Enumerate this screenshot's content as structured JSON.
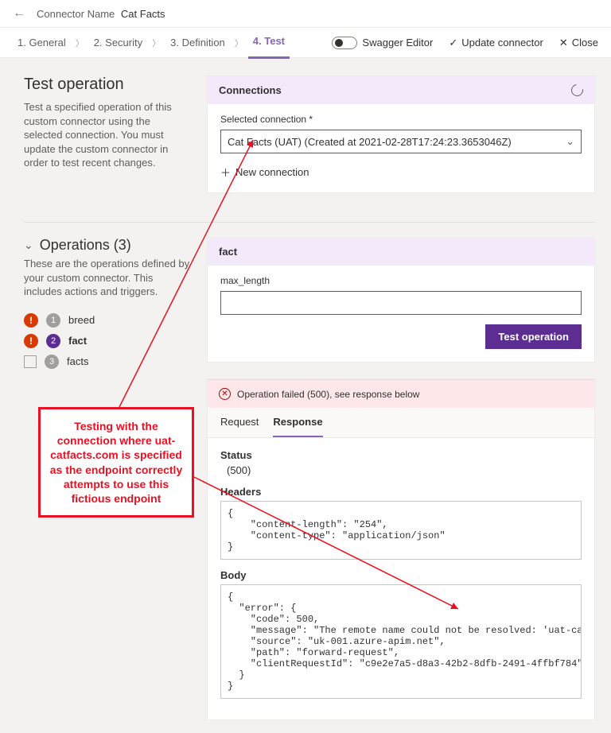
{
  "header": {
    "connector_label": "Connector Name",
    "connector_value": "Cat Facts"
  },
  "tabs": {
    "general": "1. General",
    "security": "2. Security",
    "definition": "3. Definition",
    "test": "4. Test",
    "swagger": "Swagger Editor",
    "update": "Update connector",
    "close": "Close"
  },
  "test_op": {
    "title": "Test operation",
    "desc": "Test a specified operation of this custom connector using the selected connection. You must update the custom connector in order to test recent changes."
  },
  "connections": {
    "header": "Connections",
    "selected_label": "Selected connection *",
    "selected_value": "Cat Facts (UAT) (Created at 2021-02-28T17:24:23.3653046Z)",
    "new_connection": "New connection"
  },
  "operations": {
    "title": "Operations (3)",
    "desc": "These are the operations defined by your custom connector. This includes actions and triggers.",
    "items": [
      {
        "num": "1",
        "name": "breed",
        "alert": true,
        "selected": false
      },
      {
        "num": "2",
        "name": "fact",
        "alert": true,
        "selected": true
      },
      {
        "num": "3",
        "name": "facts",
        "alert": false,
        "selected": false
      }
    ]
  },
  "fact_card": {
    "header": "fact",
    "param_label": "max_length",
    "param_value": "",
    "button": "Test operation"
  },
  "result": {
    "error_banner": "Operation failed (500), see response below",
    "tabs": {
      "request": "Request",
      "response": "Response"
    },
    "status_label": "Status",
    "status_value": "(500)",
    "headers_label": "Headers",
    "headers_text": "{\n    \"content-length\": \"254\",\n    \"content-type\": \"application/json\"\n}",
    "body_label": "Body",
    "body_text": "{\n  \"error\": {\n    \"code\": 500,\n    \"message\": \"The remote name could not be resolved: 'uat-catfacts.com'\",\n    \"source\": \"uk-001.azure-apim.net\",\n    \"path\": \"forward-request\",\n    \"clientRequestId\": \"c9e2e7a5-d8a3-42b2-8dfb-2491-4ffbf784\"\n  }\n}"
  },
  "callout": "Testing with the connection where uat-catfacts.com is specified as the endpoint correctly attempts to use this fictious endpoint"
}
